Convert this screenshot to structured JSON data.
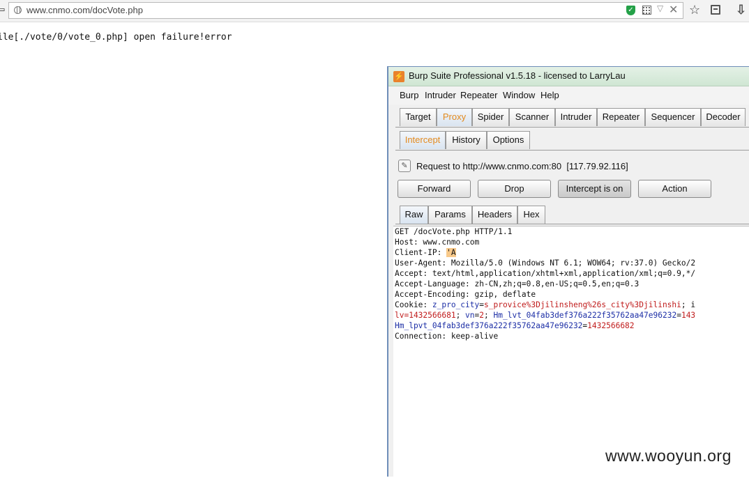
{
  "browser": {
    "url": "www.cnmo.com/docVote.php"
  },
  "page": {
    "message": "ile[./vote/0/vote_0.php] open failure!error"
  },
  "burp": {
    "title": "Burp Suite Professional v1.5.18 - licensed to LarryLau",
    "menu": [
      "Burp",
      "Intruder",
      "Repeater",
      "Window",
      "Help"
    ],
    "main_tabs": [
      "Target",
      "Proxy",
      "Spider",
      "Scanner",
      "Intruder",
      "Repeater",
      "Sequencer",
      "Decoder"
    ],
    "active_main_tab": "Proxy",
    "proxy_tabs": [
      "Intercept",
      "History",
      "Options"
    ],
    "active_proxy_tab": "Intercept",
    "request_line": "Request to http://www.cnmo.com:80  [117.79.92.116]",
    "buttons": {
      "forward": "Forward",
      "drop": "Drop",
      "intercept": "Intercept is on",
      "action": "Action"
    },
    "view_tabs": [
      "Raw",
      "Params",
      "Headers",
      "Hex"
    ],
    "active_view_tab": "Raw",
    "request": {
      "l1": "GET /docVote.php HTTP/1.1",
      "l2": "Host: www.cnmo.com",
      "l3_key": "Client-IP: ",
      "l3_val": "'A",
      "l4": "User-Agent: Mozilla/5.0 (Windows NT 6.1; WOW64; rv:37.0) Gecko/2",
      "l5": "Accept: text/html,application/xhtml+xml,application/xml;q=0.9,*/",
      "l6": "Accept-Language: zh-CN,zh;q=0.8,en-US;q=0.5,en;q=0.3",
      "l7": "Accept-Encoding: gzip, deflate",
      "l8_key": "Cookie: ",
      "l8_name1": "z_pro_city",
      "l8_eq1": "=",
      "l8_val1": "s_provice%3Djilinsheng%26s_city%3Djilinshi",
      "l8_rest": "; i",
      "l9_val": "lv=1432566681",
      "l9_sep": "; ",
      "l9_name": "vn",
      "l9_eq": "=",
      "l9_val2": "2",
      "l9_sep2": "; ",
      "l9_name2": "Hm_lvt_04fab3def376a222f35762aa47e96232",
      "l9_eq2": "=",
      "l9_tail": "143",
      "l10_name": "Hm_lpvt_04fab3def376a222f35762aa47e96232",
      "l10_eq": "=",
      "l10_val": "1432566682",
      "l11": "Connection: keep-alive"
    }
  },
  "watermark": "www.wooyun.org",
  "colors": {
    "accent_tab": "#e38a1e",
    "cookie_value": "#c01b1b",
    "cookie_name": "#1d2fa6",
    "highlight": "#f8c98a"
  }
}
